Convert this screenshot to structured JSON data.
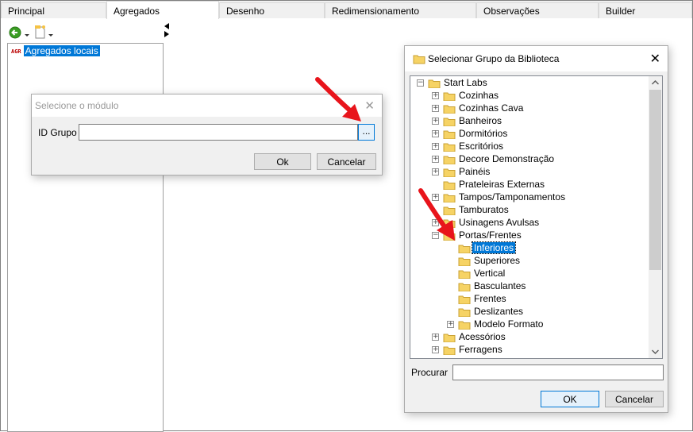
{
  "tabs": [
    "Principal",
    "Agregados",
    "Desenho",
    "Redimensionamento",
    "Observações",
    "Builder"
  ],
  "left_panel": {
    "agr_tag": "AGR",
    "item": "Agregados locais"
  },
  "module_dialog": {
    "title": "Selecione o módulo",
    "id_label": "ID Grupo",
    "id_value": "",
    "browse_label": "...",
    "ok_label": "Ok",
    "cancel_label": "Cancelar"
  },
  "library_dialog": {
    "title": "Selecionar Grupo da Biblioteca",
    "search_label": "Procurar",
    "search_value": "",
    "ok_label": "OK",
    "cancel_label": "Cancelar",
    "tree": [
      {
        "label": "Start Labs",
        "level": 0,
        "exp": "−"
      },
      {
        "label": "Cozinhas",
        "level": 1,
        "exp": "+"
      },
      {
        "label": "Cozinhas Cava",
        "level": 1,
        "exp": "+"
      },
      {
        "label": "Banheiros",
        "level": 1,
        "exp": "+"
      },
      {
        "label": "Dormitórios",
        "level": 1,
        "exp": "+"
      },
      {
        "label": "Escritórios",
        "level": 1,
        "exp": "+"
      },
      {
        "label": "Decore Demonstração",
        "level": 1,
        "exp": "+"
      },
      {
        "label": "Painéis",
        "level": 1,
        "exp": "+"
      },
      {
        "label": "Prateleiras Externas",
        "level": 1,
        "exp": ""
      },
      {
        "label": "Tampos/Tamponamentos",
        "level": 1,
        "exp": "+"
      },
      {
        "label": "Tamburatos",
        "level": 1,
        "exp": ""
      },
      {
        "label": "Usinagens Avulsas",
        "level": 1,
        "exp": "+"
      },
      {
        "label": "Portas/Frentes",
        "level": 1,
        "exp": "−"
      },
      {
        "label": "Inferiores",
        "level": 2,
        "exp": "",
        "selected": true
      },
      {
        "label": "Superiores",
        "level": 2,
        "exp": ""
      },
      {
        "label": "Vertical",
        "level": 2,
        "exp": ""
      },
      {
        "label": "Basculantes",
        "level": 2,
        "exp": ""
      },
      {
        "label": "Frentes",
        "level": 2,
        "exp": ""
      },
      {
        "label": "Deslizantes",
        "level": 2,
        "exp": ""
      },
      {
        "label": "Modelo Formato",
        "level": 2,
        "exp": "+"
      },
      {
        "label": "Acessórios",
        "level": 1,
        "exp": "+"
      },
      {
        "label": "Ferragens",
        "level": 1,
        "exp": "+"
      }
    ]
  },
  "colors": {
    "selection": "#0078d7",
    "arrow": "#e8141b",
    "folder": "#f6d365",
    "folder_edge": "#c8a033"
  }
}
